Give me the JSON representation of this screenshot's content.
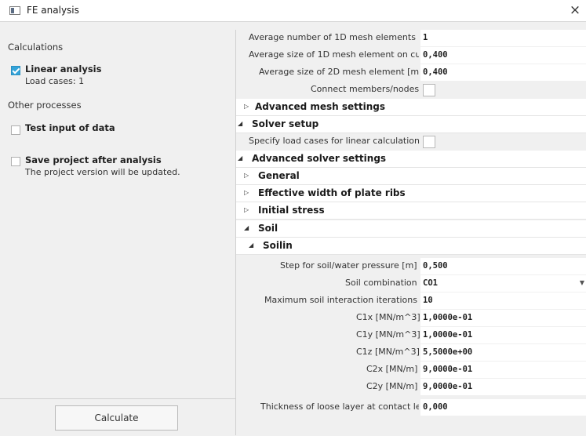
{
  "window": {
    "title": "FE analysis",
    "close_label": "×"
  },
  "left": {
    "calculations_heading": "Calculations",
    "linear_analysis_label": "Linear analysis",
    "load_cases_text": "Load cases: 1",
    "linear_analysis_checked": true,
    "other_processes_heading": "Other processes",
    "test_input_label": "Test input of data",
    "test_input_checked": false,
    "save_project_label": "Save project after analysis",
    "save_project_note": "The project version will be updated.",
    "save_project_checked": false,
    "calculate_button": "Calculate"
  },
  "props": {
    "avg_num_1d_label": "Average number of 1D mesh elements (",
    "avg_num_1d_value": "1",
    "avg_size_1d_label": "Average size of 1D mesh element on cu",
    "avg_size_1d_value": "0,400",
    "avg_size_2d_label": "Average size of 2D mesh element [m]",
    "avg_size_2d_value": "0,400",
    "connect_label": "Connect members/nodes",
    "advanced_mesh": "Advanced mesh settings",
    "solver_setup": "Solver setup",
    "specify_load_cases_label": "Specify load cases for linear calculation",
    "advanced_solver": "Advanced solver settings",
    "general": "General",
    "effective_width": "Effective width of plate ribs",
    "initial_stress": "Initial stress",
    "soil": "Soil",
    "soilin": "Soilin",
    "step_label": "Step for soil/water pressure [m]",
    "step_value": "0,500",
    "soil_comb_label": "Soil combination",
    "soil_comb_value": "CO1",
    "max_iter_label": "Maximum soil interaction iterations",
    "max_iter_value": "10",
    "c1x_label": "C1x [MN/m^3]",
    "c1x_value": "1,0000e-01",
    "c1y_label": "C1y [MN/m^3]",
    "c1y_value": "1,0000e-01",
    "c1z_label": "C1z [MN/m^3]",
    "c1z_value": "5,5000e+00",
    "c2x_label": "C2x [MN/m]",
    "c2x_value": "9,0000e-01",
    "c2y_label": "C2y [MN/m]",
    "c2y_value": "9,0000e-01",
    "thickness_label": "Thickness of loose layer at contact le",
    "thickness_value": "0,000"
  }
}
